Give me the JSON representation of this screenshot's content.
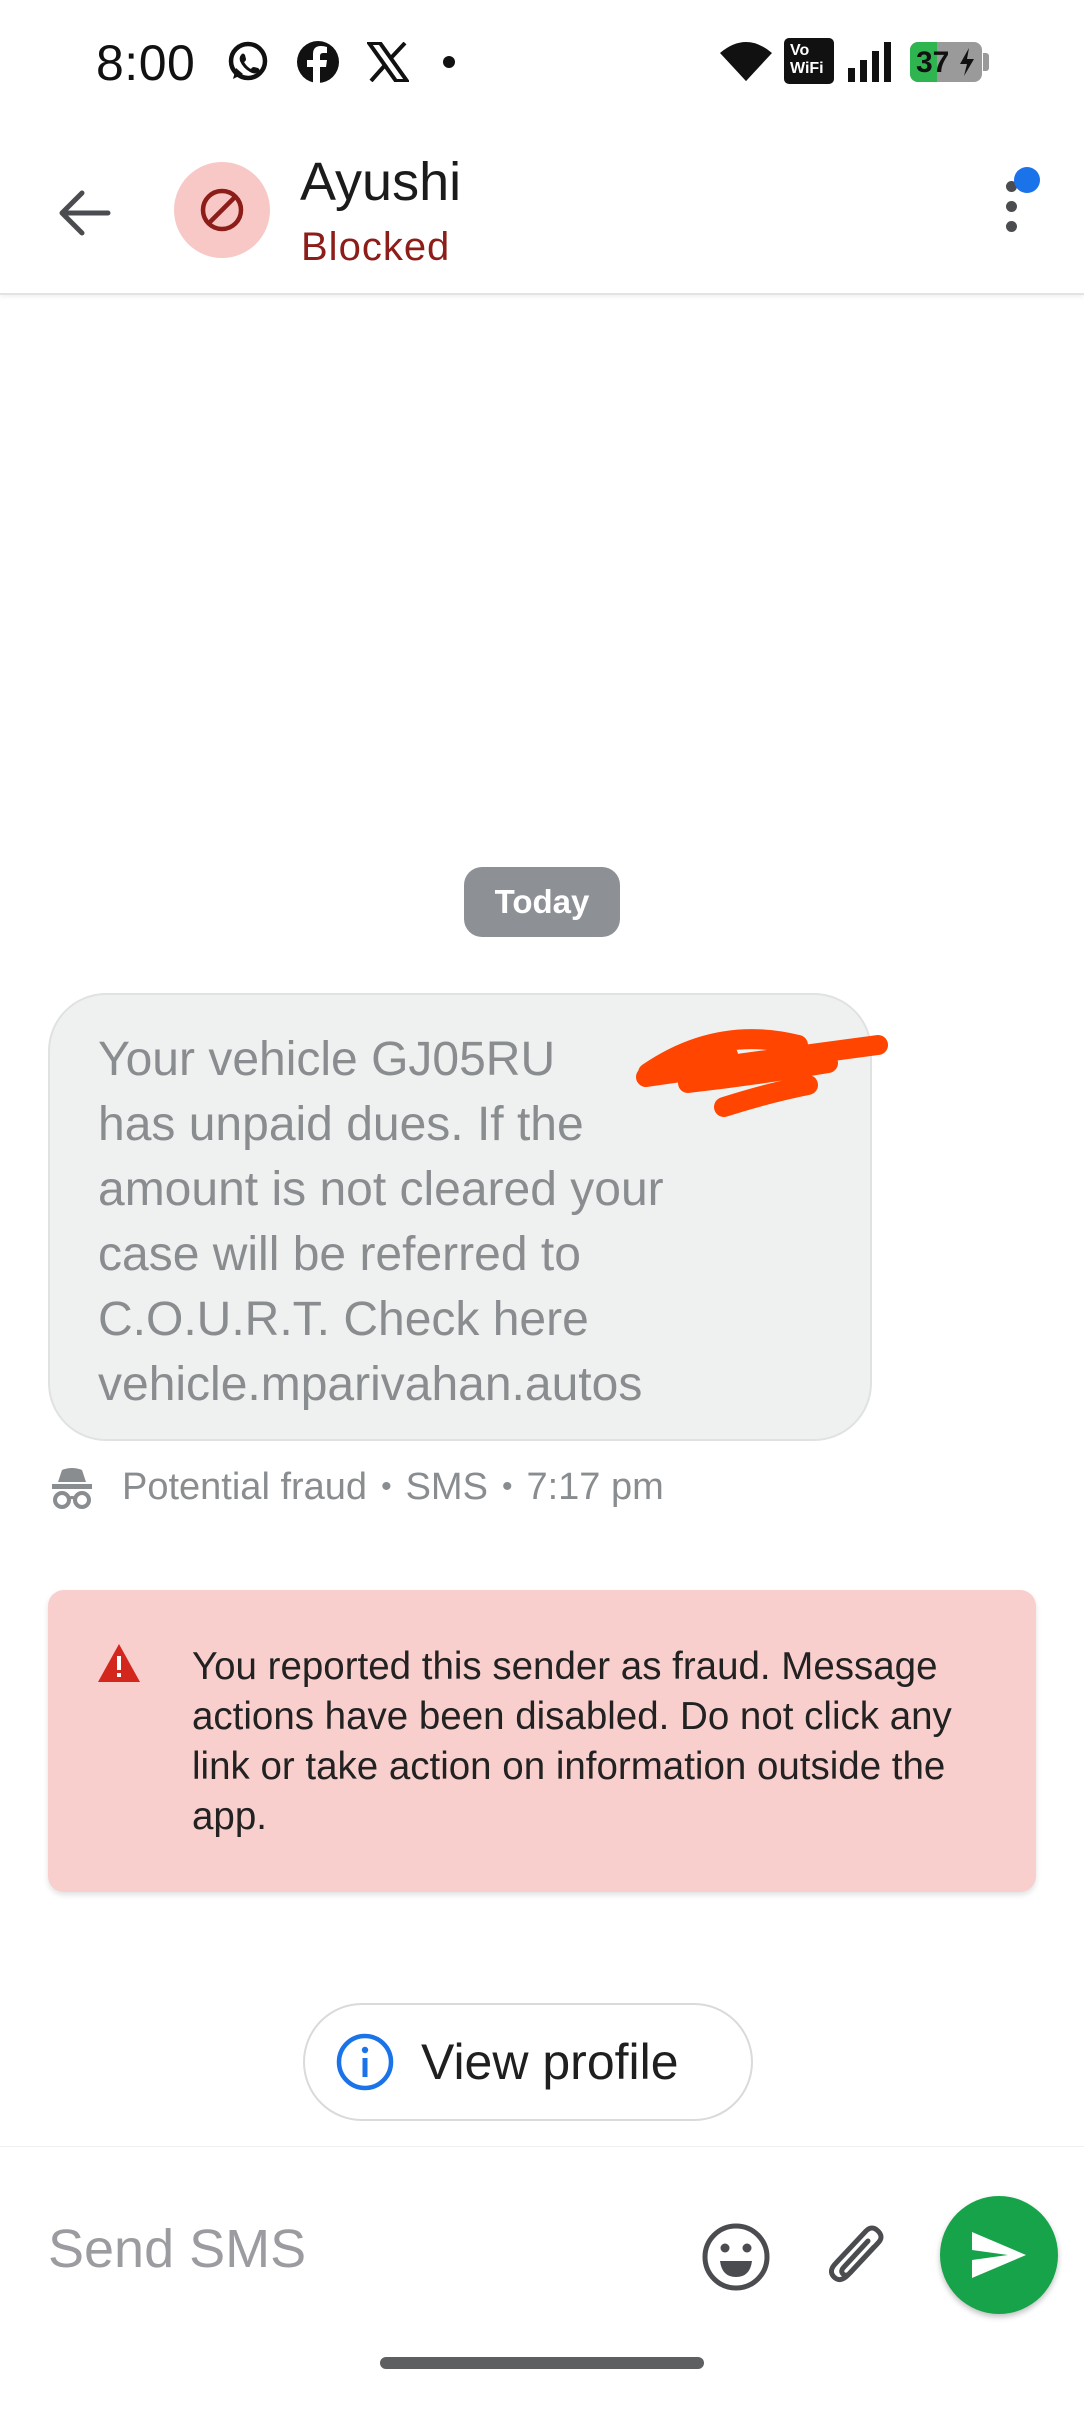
{
  "status_bar": {
    "time": "8:00",
    "notification_icons": [
      "whatsapp-icon",
      "facebook-icon",
      "x-icon",
      "notification-dot-icon"
    ],
    "system_icons": [
      "wifi-icon",
      "vowifi-icon",
      "signal-icon",
      "battery-icon"
    ],
    "vowifi_label_top": "Vo",
    "vowifi_label_bottom": "WiFi",
    "battery_level": "37",
    "battery_charging": true,
    "battery_color": "#2fb550"
  },
  "header": {
    "contact_name": "Ayushi",
    "contact_status": "Blocked",
    "avatar_icon": "blocked-icon",
    "more_icon": "more-vert-icon",
    "has_unread_dot": true
  },
  "conversation": {
    "date_chip": "Today",
    "message": {
      "text": "Your vehicle GJ05RU\nhas unpaid dues. If the\namount is not cleared your\ncase will be referred to\nC.O.U.R.T. Check here\nvehicle.mparivahan.autos",
      "label": "Potential fraud",
      "channel": "SMS",
      "time": "7:17 pm",
      "label_icon": "spy-icon"
    },
    "warning": {
      "icon": "warning-icon",
      "text": "You reported this sender as fraud. Message actions have been disabled. Do not click any link or take action on information outside the app."
    },
    "view_profile_label": "View profile"
  },
  "compose": {
    "placeholder": "Send SMS",
    "value": "",
    "emoji_icon": "emoji-icon",
    "attach_icon": "attach-icon",
    "send_icon": "send-icon"
  },
  "colors": {
    "accent_blue": "#1a73e8",
    "blocked_red": "#8c1d18",
    "warning_bg": "#f9cfcd",
    "send_green": "#17a34a",
    "redaction": "#ff4500"
  }
}
